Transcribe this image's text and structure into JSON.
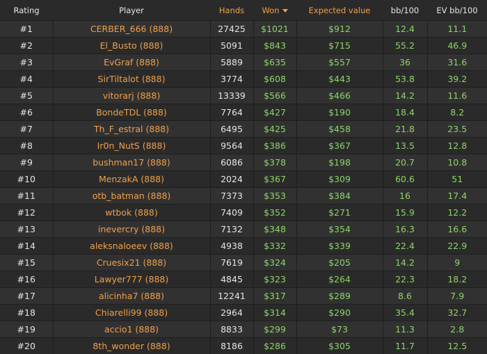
{
  "colors": {
    "background": "#2a2a2a",
    "row_alt": "#313131",
    "header_text": "#e6e6e6",
    "accent_orange": "#f0a04b",
    "positive_green": "#8fd46a"
  },
  "table": {
    "sorted_by": "won",
    "sort_direction": "descending",
    "headers": {
      "rating": "Rating",
      "player": "Player",
      "hands": "Hands",
      "won": "Won",
      "expected_value": "Expected value",
      "bb100": "bb/100",
      "ev_bb100": "EV bb/100"
    },
    "rows": [
      {
        "rating": "#1",
        "player": "CERBER_666 (888)",
        "hands": "27425",
        "won": "$1021",
        "ev": "$912",
        "bb100": "12.4",
        "evbb100": "11.1"
      },
      {
        "rating": "#2",
        "player": "El_Busto (888)",
        "hands": "5091",
        "won": "$843",
        "ev": "$715",
        "bb100": "55.2",
        "evbb100": "46.9"
      },
      {
        "rating": "#3",
        "player": "EvGraf (888)",
        "hands": "5889",
        "won": "$635",
        "ev": "$557",
        "bb100": "36",
        "evbb100": "31.6"
      },
      {
        "rating": "#4",
        "player": "SirTiltalot (888)",
        "hands": "3774",
        "won": "$608",
        "ev": "$443",
        "bb100": "53.8",
        "evbb100": "39.2"
      },
      {
        "rating": "#5",
        "player": "vitorarj (888)",
        "hands": "13339",
        "won": "$566",
        "ev": "$466",
        "bb100": "14.2",
        "evbb100": "11.6"
      },
      {
        "rating": "#6",
        "player": "BondeTDL (888)",
        "hands": "7764",
        "won": "$427",
        "ev": "$190",
        "bb100": "18.4",
        "evbb100": "8.2"
      },
      {
        "rating": "#7",
        "player": "Th_F_estral (888)",
        "hands": "6495",
        "won": "$425",
        "ev": "$458",
        "bb100": "21.8",
        "evbb100": "23.5"
      },
      {
        "rating": "#8",
        "player": "Ir0n_NutS (888)",
        "hands": "9564",
        "won": "$386",
        "ev": "$367",
        "bb100": "13.5",
        "evbb100": "12.8"
      },
      {
        "rating": "#9",
        "player": "bushman17 (888)",
        "hands": "6086",
        "won": "$378",
        "ev": "$198",
        "bb100": "20.7",
        "evbb100": "10.8"
      },
      {
        "rating": "#10",
        "player": "MenzakA (888)",
        "hands": "2024",
        "won": "$367",
        "ev": "$309",
        "bb100": "60.6",
        "evbb100": "51"
      },
      {
        "rating": "#11",
        "player": "otb_batman (888)",
        "hands": "7373",
        "won": "$353",
        "ev": "$384",
        "bb100": "16",
        "evbb100": "17.4"
      },
      {
        "rating": "#12",
        "player": "wtbok (888)",
        "hands": "7409",
        "won": "$352",
        "ev": "$271",
        "bb100": "15.9",
        "evbb100": "12.2"
      },
      {
        "rating": "#13",
        "player": "inevercry (888)",
        "hands": "7132",
        "won": "$348",
        "ev": "$354",
        "bb100": "16.3",
        "evbb100": "16.6"
      },
      {
        "rating": "#14",
        "player": "aleksnaloeev (888)",
        "hands": "4938",
        "won": "$332",
        "ev": "$339",
        "bb100": "22.4",
        "evbb100": "22.9"
      },
      {
        "rating": "#15",
        "player": "Cruesix21 (888)",
        "hands": "7619",
        "won": "$324",
        "ev": "$205",
        "bb100": "14.2",
        "evbb100": "9"
      },
      {
        "rating": "#16",
        "player": "Lawyer777 (888)",
        "hands": "4845",
        "won": "$323",
        "ev": "$264",
        "bb100": "22.3",
        "evbb100": "18.2"
      },
      {
        "rating": "#17",
        "player": "alicinha7 (888)",
        "hands": "12241",
        "won": "$317",
        "ev": "$289",
        "bb100": "8.6",
        "evbb100": "7.9"
      },
      {
        "rating": "#18",
        "player": "Chiarelli99 (888)",
        "hands": "2964",
        "won": "$314",
        "ev": "$290",
        "bb100": "35.4",
        "evbb100": "32.7"
      },
      {
        "rating": "#19",
        "player": "accio1 (888)",
        "hands": "8833",
        "won": "$299",
        "ev": "$73",
        "bb100": "11.3",
        "evbb100": "2.8"
      },
      {
        "rating": "#20",
        "player": "8th_wonder (888)",
        "hands": "8186",
        "won": "$286",
        "ev": "$305",
        "bb100": "11.7",
        "evbb100": "12.5"
      }
    ]
  }
}
